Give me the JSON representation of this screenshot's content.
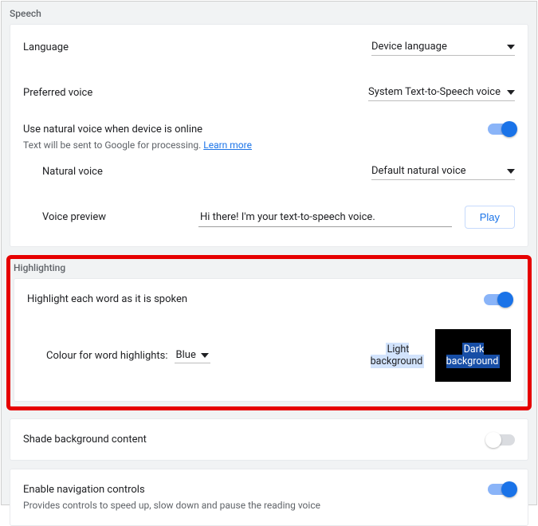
{
  "speech": {
    "title": "Speech",
    "language_label": "Language",
    "language_value": "Device language",
    "preferred_voice_label": "Preferred voice",
    "preferred_voice_value": "System Text-to-Speech voice",
    "natural_voice_label": "Use natural voice when device is online",
    "natural_voice_sub": "Text will be sent to Google for processing.",
    "learn_more": "Learn more",
    "natural_voice_on": true,
    "natural_voice_row_label": "Natural voice",
    "natural_voice_value": "Default natural voice",
    "voice_preview_label": "Voice preview",
    "voice_preview_value": "Hi there! I'm your text-to-speech voice.",
    "play_label": "Play"
  },
  "highlighting": {
    "title": "Highlighting",
    "each_word_label": "Highlight each word as it is spoken",
    "each_word_on": true,
    "color_label": "Colour for word highlights:",
    "color_value": "Blue",
    "preview_light": "Light background",
    "preview_dark": "Dark background"
  },
  "shade": {
    "label": "Shade background content",
    "on": false
  },
  "nav": {
    "label": "Enable navigation controls",
    "sub": "Provides controls to speed up, slow down and pause the reading voice",
    "on": true
  }
}
